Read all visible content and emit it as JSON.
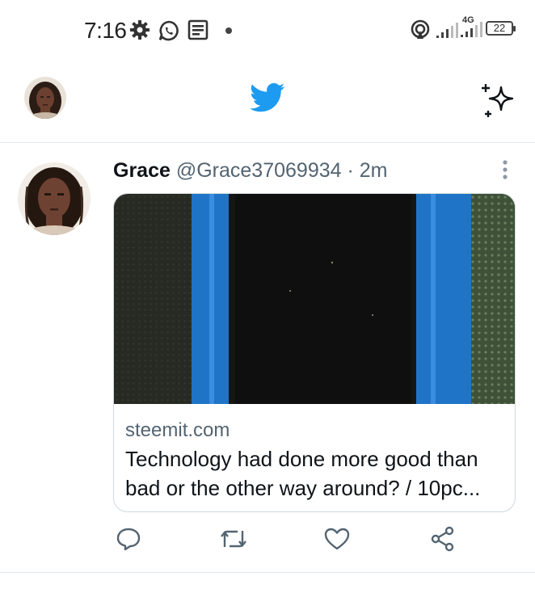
{
  "status_bar": {
    "time": "7:16",
    "network": "4G",
    "battery": "22",
    "icons": [
      "gear-icon",
      "whatsapp-icon",
      "news-icon",
      "dot-icon",
      "hotspot-icon",
      "signal-icon",
      "signal-4g-icon",
      "battery-icon"
    ]
  },
  "header": {
    "logo": "twitter-bird-icon",
    "right_icon": "sparkle-icon"
  },
  "tweet": {
    "author_name": "Grace",
    "handle": "@Grace37069934",
    "time": "· 2m",
    "card": {
      "domain": "steemit.com",
      "title": "Technology had done more good than bad or the other way around? / 10pc..."
    },
    "actions": [
      "reply-icon",
      "retweet-icon",
      "like-icon",
      "share-icon"
    ]
  },
  "colors": {
    "twitter_blue": "#1d9bf0",
    "text_primary": "#0f1419",
    "text_secondary": "#536471",
    "border": "#e1e8ed"
  }
}
